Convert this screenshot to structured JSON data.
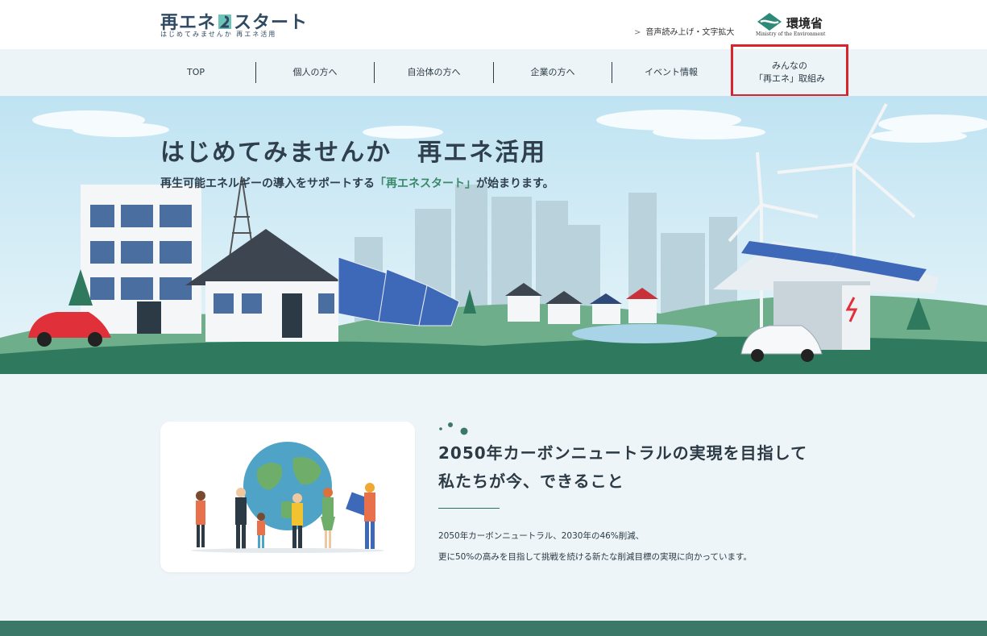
{
  "header": {
    "logo_main": "再エネ",
    "logo_main_tail": "スタート",
    "logo_sub": "はじめてみませんか 再エネ活用",
    "util_link": "音声読み上げ・文字拡大",
    "ministry_name": "環境省",
    "ministry_en": "Ministry of the Environment"
  },
  "nav": {
    "items": [
      {
        "label": "TOP"
      },
      {
        "label": "個人の方へ"
      },
      {
        "label": "自治体の方へ"
      },
      {
        "label": "企業の方へ"
      },
      {
        "label": "イベント情報"
      },
      {
        "label_line1": "みんなの",
        "label_line2": "「再エネ」取組み"
      }
    ]
  },
  "hero": {
    "title": "はじめてみませんか　再エネ活用",
    "sub_before": "再生可能エネルギーの導入をサポートする",
    "sub_highlight": "「再エネスタート」",
    "sub_after": "が始まります。"
  },
  "mission": {
    "title_line1": "2050年カーボンニュートラルの実現を目指して",
    "title_line2": "私たちが今、できること",
    "body_line1": "2050年カーボンニュートラル、2030年の46%削減、",
    "body_line2": "更に50%の高みを目指して挑戦を続ける新たな削減目標の実現に向かっています。"
  },
  "colors": {
    "accent_green": "#3c7868",
    "nav_bg": "#edf4f7",
    "highlight_box": "#d9232d",
    "text_dark": "#2b3a44"
  }
}
